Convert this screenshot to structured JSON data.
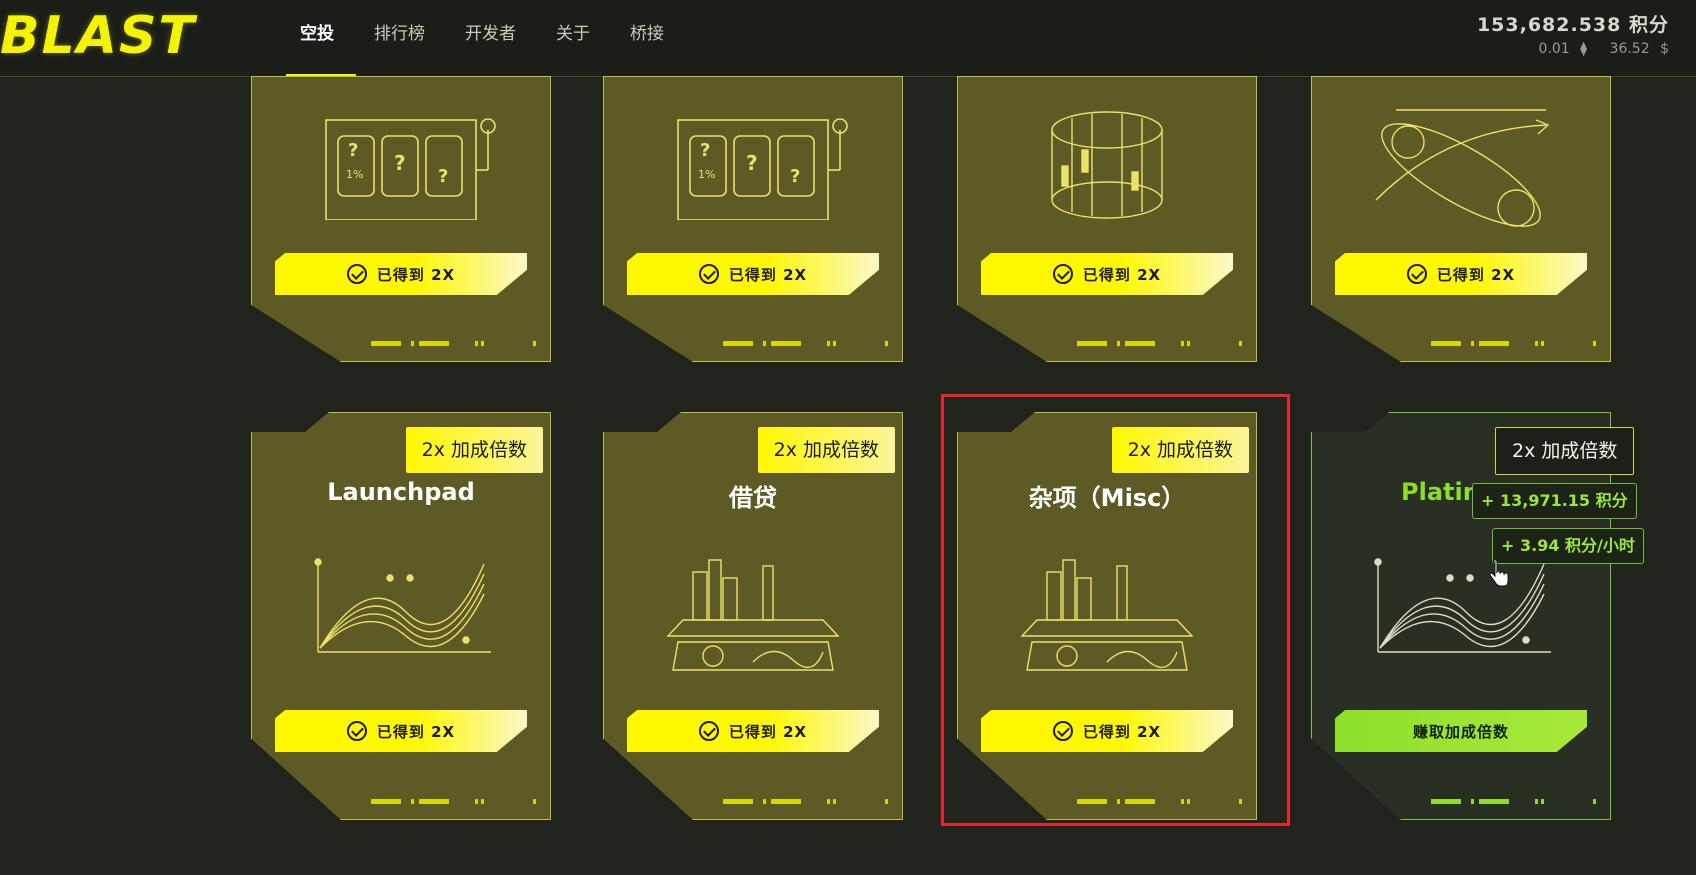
{
  "header": {
    "logo": "BLAST",
    "nav": [
      "空投",
      "排行榜",
      "开发者",
      "关于",
      "桥接"
    ],
    "points_value": "153,682.538 积分",
    "eth_amount": "0.01",
    "usd_amount": "36.52"
  },
  "top_cards": [
    {
      "status": "已得到 2X"
    },
    {
      "status": "已得到 2X"
    },
    {
      "status": "已得到 2X"
    },
    {
      "status": "已得到 2X"
    }
  ],
  "bottom_cards": [
    {
      "badge": "2x 加成倍数",
      "title": "Launchpad",
      "status": "已得到 2X"
    },
    {
      "badge": "2x 加成倍数",
      "title": "借贷",
      "status": "已得到 2X"
    },
    {
      "badge": "2x 加成倍数",
      "title": "杂项（Misc）",
      "status": "已得到 2X"
    },
    {
      "badge": "2x 加成倍数",
      "title": "Platinum",
      "status": "赚取加成倍数"
    }
  ],
  "tooltips": {
    "points_total": "+ 13,971.15 积分",
    "points_rate": "+ 3.94 积分/小时"
  },
  "colors": {
    "accent": "#f4f400",
    "green": "#8cdc2a",
    "card": "#5d5a25",
    "highlight_border": "#e2272f"
  }
}
